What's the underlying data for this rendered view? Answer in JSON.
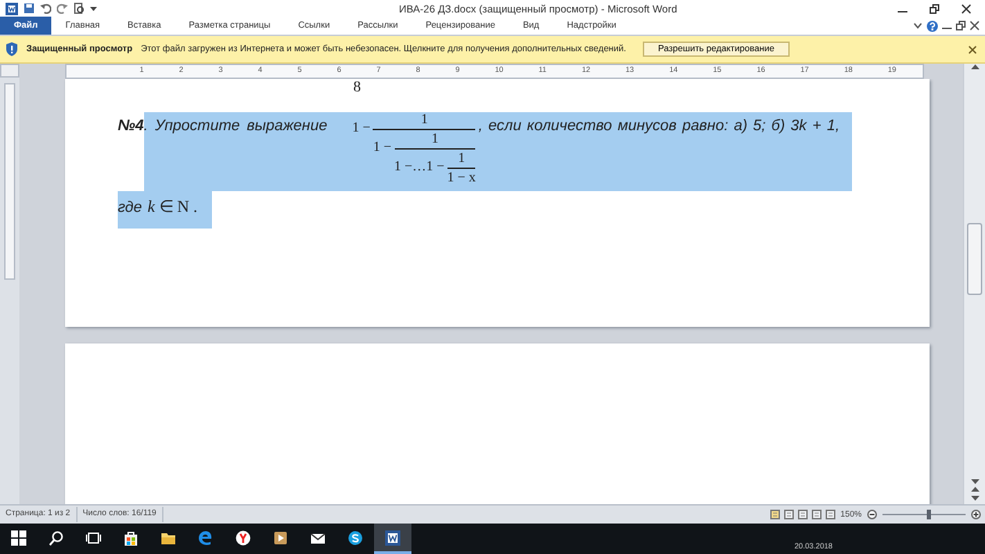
{
  "window": {
    "title": "ИВА-26 ДЗ.docx (защищенный просмотр)  -  Microsoft Word"
  },
  "ribbon_tabs": [
    {
      "label": "Файл",
      "selected": true
    },
    {
      "label": "Главная",
      "selected": false
    },
    {
      "label": "Вставка",
      "selected": false
    },
    {
      "label": "Разметка страницы",
      "selected": false
    },
    {
      "label": "Ссылки",
      "selected": false
    },
    {
      "label": "Рассылки",
      "selected": false
    },
    {
      "label": "Рецензирование",
      "selected": false
    },
    {
      "label": "Вид",
      "selected": false
    },
    {
      "label": "Надстройки",
      "selected": false
    }
  ],
  "protected_view": {
    "title": "Защищенный просмотр",
    "message": "Этот файл загружен из Интернета и может быть небезопасен. Щелкните для получения дополнительных сведений.",
    "button": "Разрешить редактирование"
  },
  "ruler": {
    "numbers": [
      "1",
      "2",
      "3",
      "4",
      "5",
      "6",
      "7",
      "8",
      "9",
      "10",
      "11",
      "12",
      "13",
      "14",
      "15",
      "16",
      "17",
      "18",
      "19"
    ]
  },
  "document": {
    "page_number": "8",
    "problem": {
      "number": "№4",
      "selected": true,
      "intro": ". Упростите выражение",
      "formula": {
        "prefix": "1 −",
        "numerator": "1",
        "denominator": {
          "prefix": "1 −",
          "numerator": "1",
          "denominator": {
            "prefix": "1 −…1 −",
            "numerator": "1",
            "denominator": "1 − x"
          }
        }
      },
      "after": ", если количество минусов равно: а) 5; б) 3k + 1,",
      "where": "где",
      "condition": "*k* ∈ N ."
    }
  },
  "status_bar": {
    "page": "Страница: 1 из 2",
    "words": "Число слов: 16/119",
    "zoom": "150%",
    "zoom_slider": {
      "level": 0.55
    }
  },
  "taskbar": {
    "items": [
      {
        "kind": "start",
        "active": false
      },
      {
        "kind": "search",
        "active": false
      },
      {
        "kind": "taskview",
        "active": false
      },
      {
        "kind": "store",
        "active": false
      },
      {
        "kind": "folder",
        "active": false
      },
      {
        "kind": "edge",
        "active": false
      },
      {
        "kind": "yandex",
        "active": false
      },
      {
        "kind": "media",
        "active": false
      },
      {
        "kind": "mail",
        "active": false
      },
      {
        "kind": "skype",
        "active": false
      },
      {
        "kind": "word",
        "active": true
      }
    ],
    "date": "20.03.2018"
  }
}
